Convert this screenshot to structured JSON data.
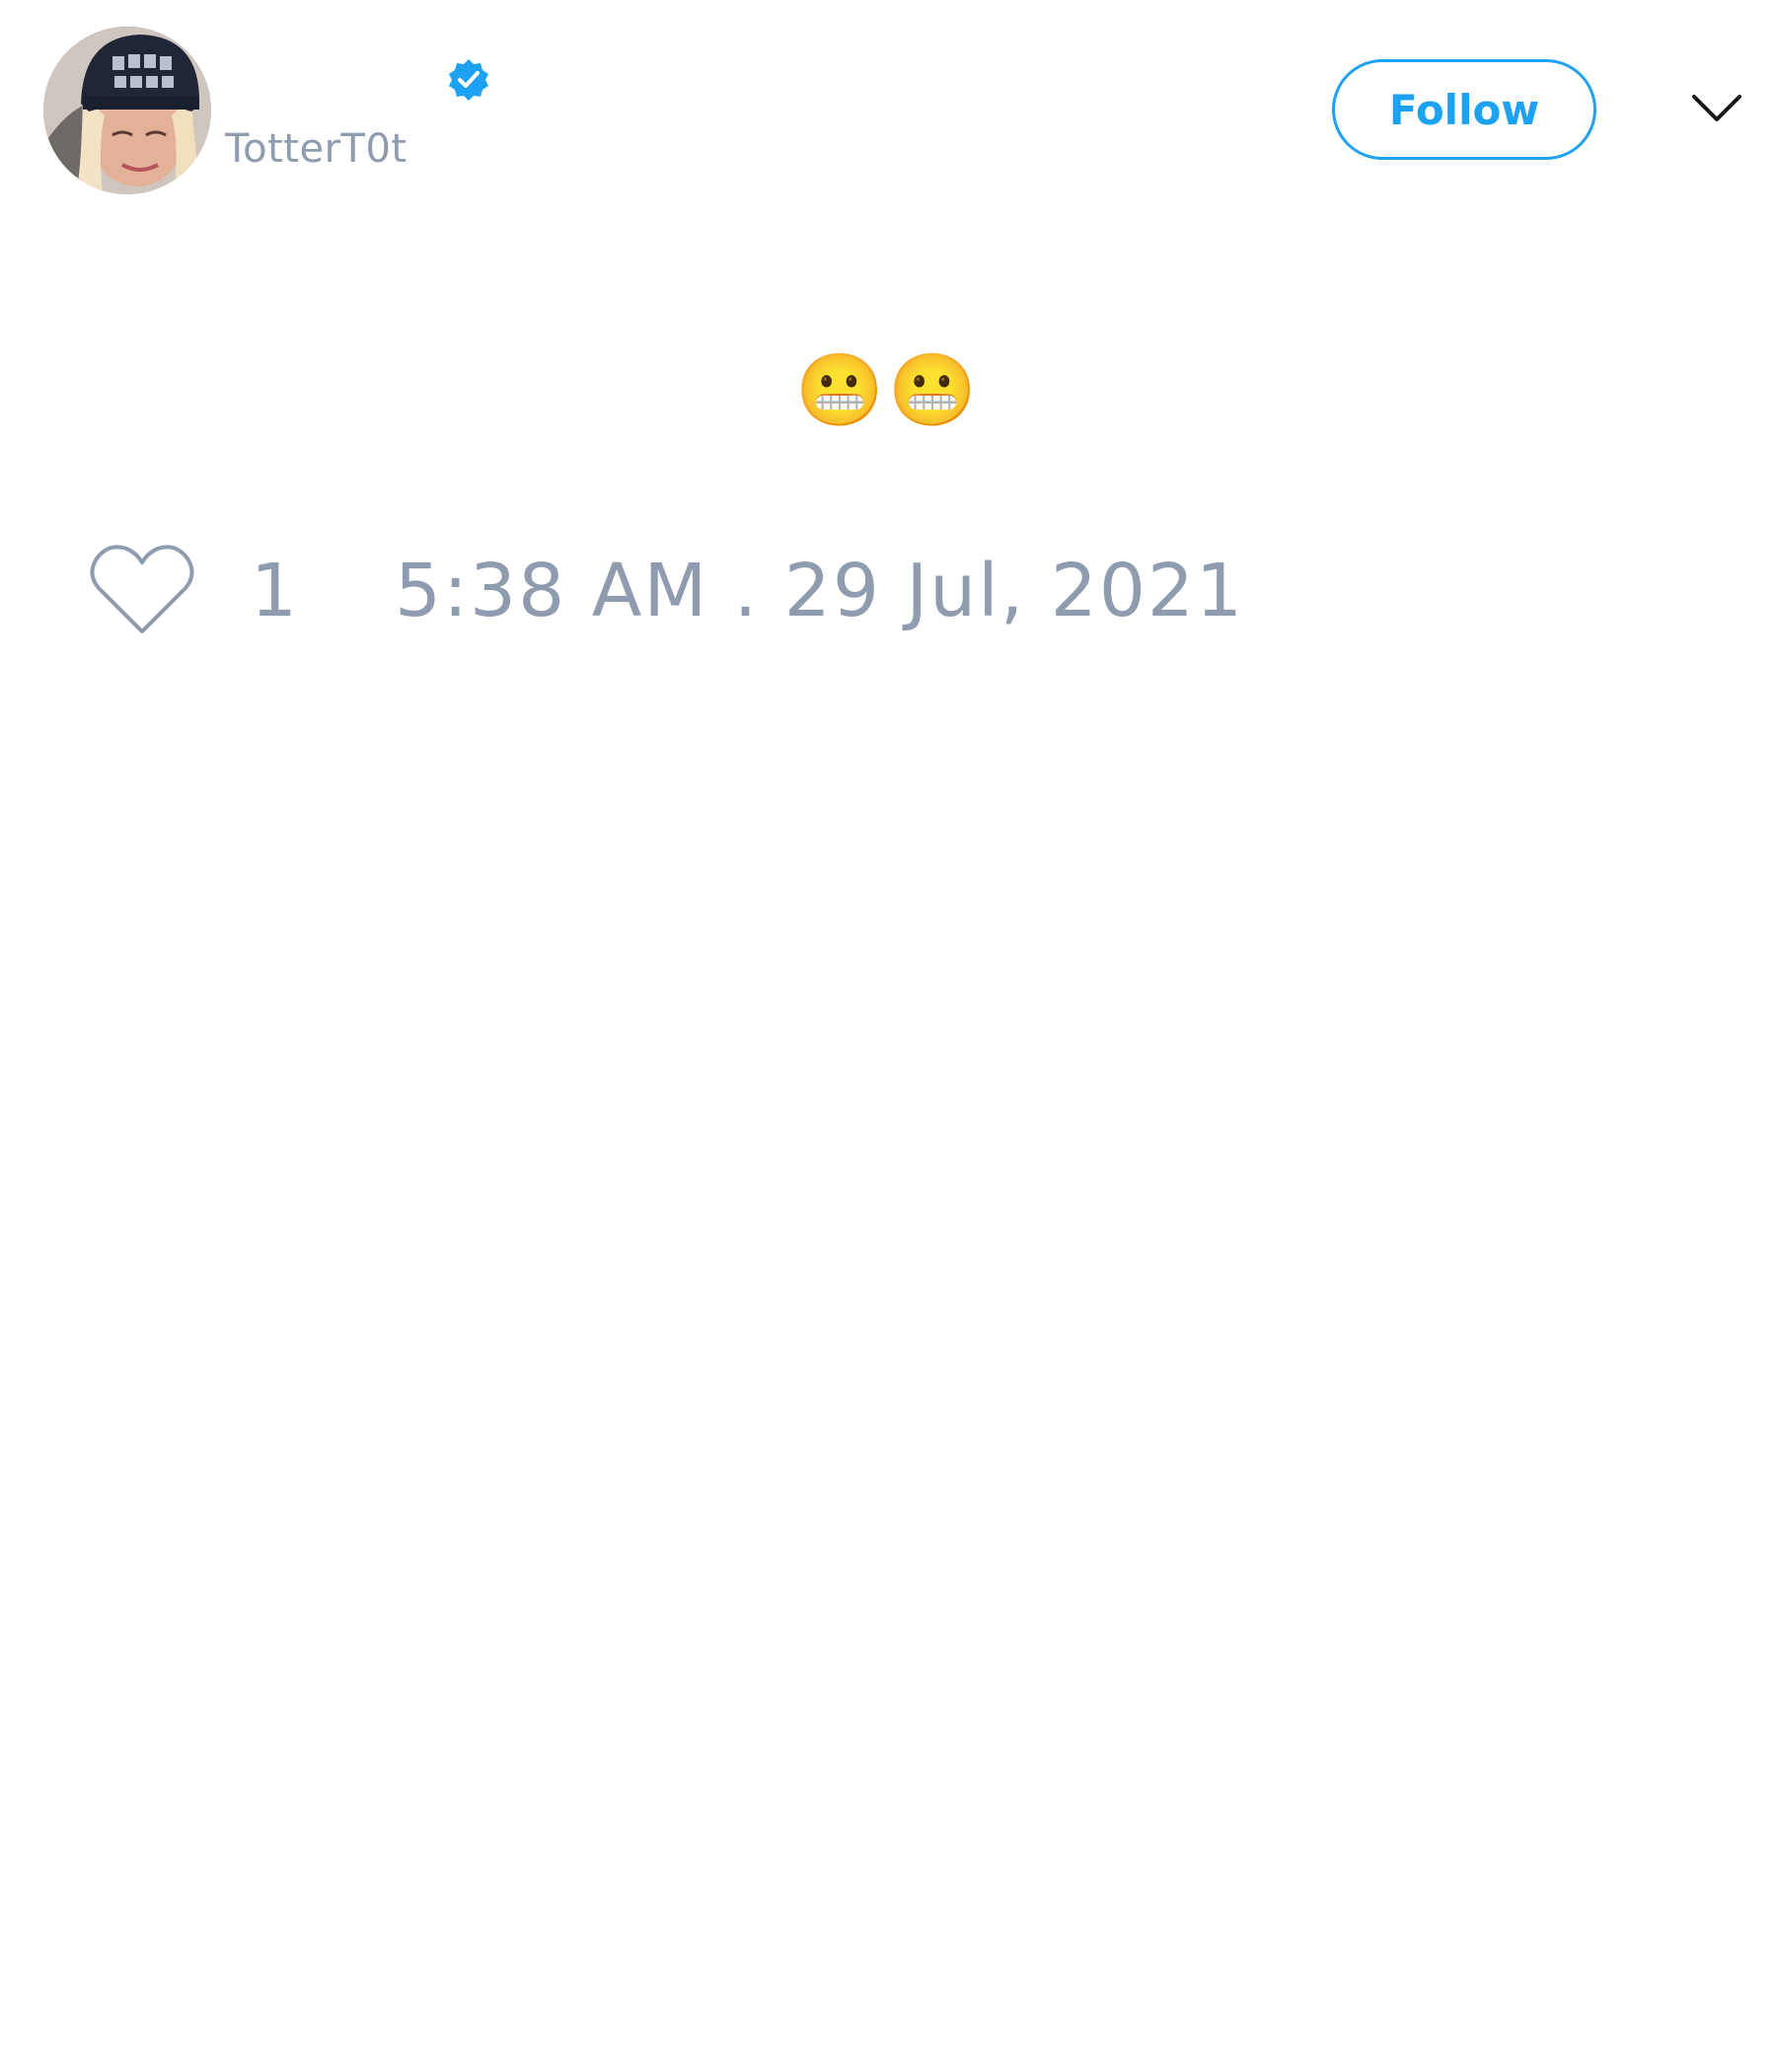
{
  "tweet": {
    "author": {
      "display_name": "",
      "username": "TotterT0t",
      "verified": true
    },
    "follow_label": "Follow",
    "text": "😬😬",
    "like_count": "1",
    "timestamp": "5:38 AM . 29 Jul, 2021"
  },
  "icons": {
    "verified": "verified-badge-icon",
    "more": "chevron-down-icon",
    "like": "heart-icon"
  },
  "colors": {
    "accent": "#1da1f2",
    "muted_text": "#8f9cb0",
    "icon_stroke": "#8f9cb0",
    "chevron": "#14171a"
  }
}
